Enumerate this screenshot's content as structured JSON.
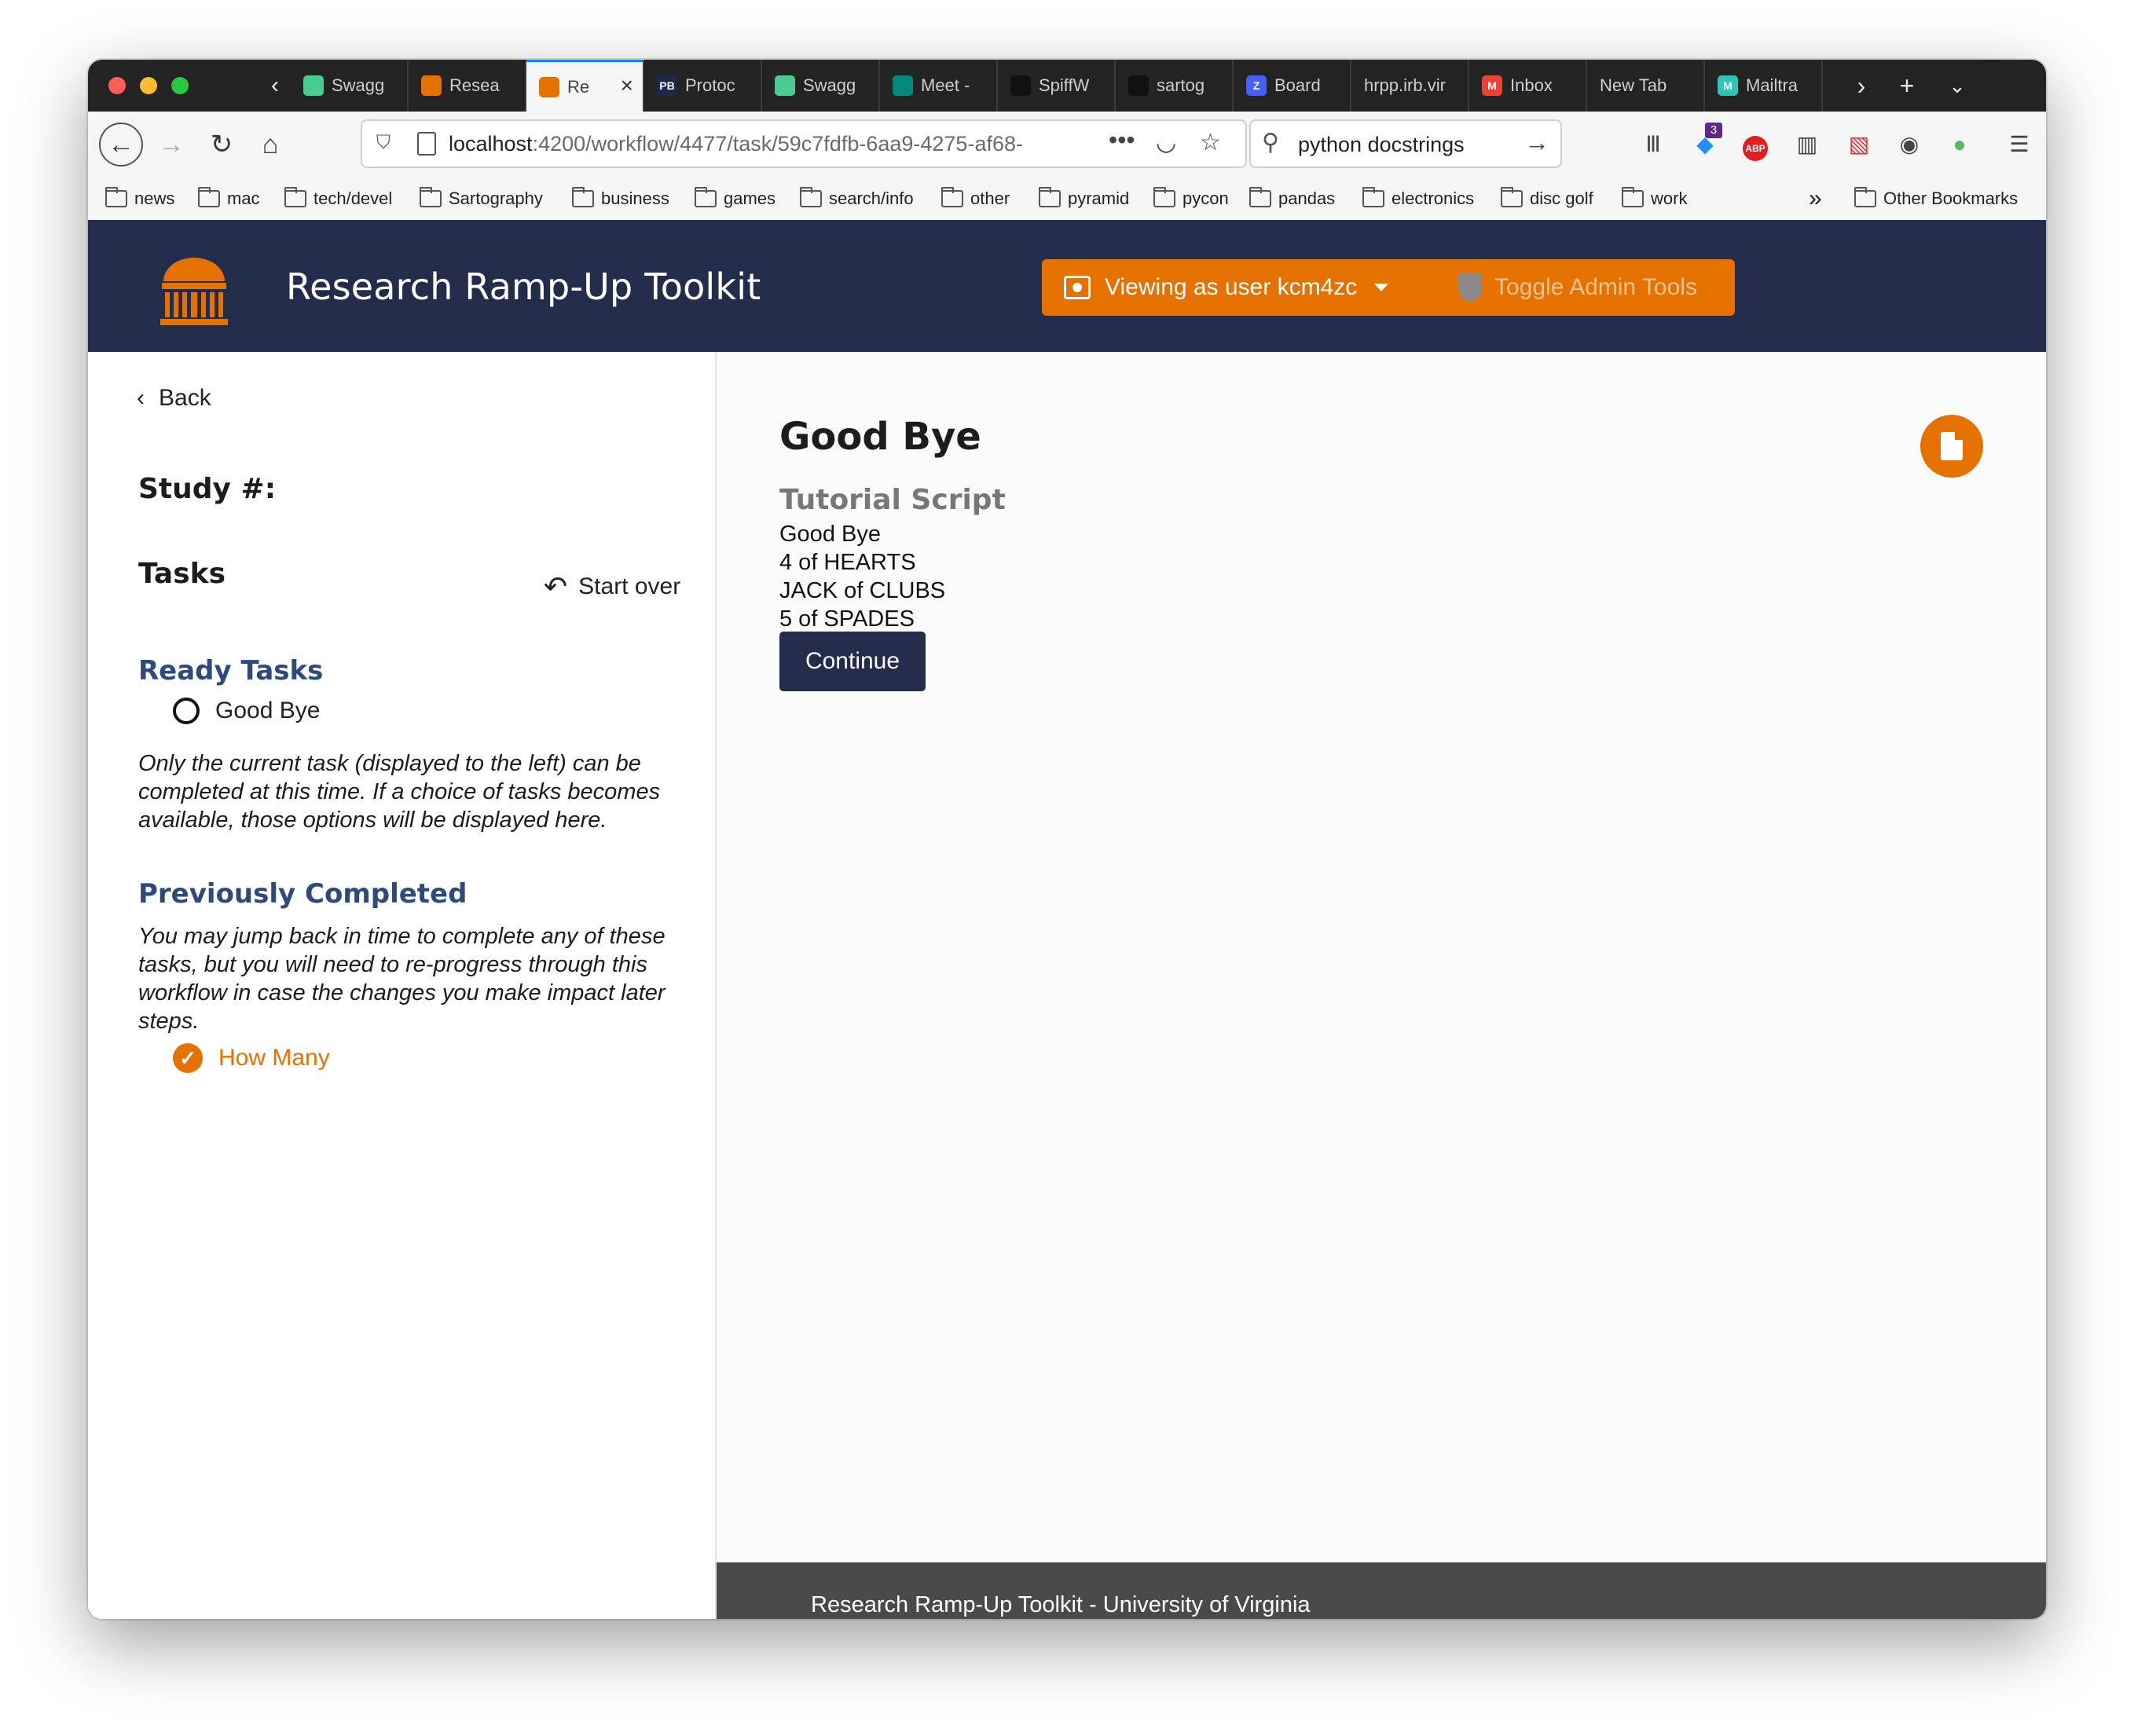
{
  "browser": {
    "tabs": [
      {
        "label": "Swagg",
        "icon": "swagger-icon",
        "color": "#49cc90"
      },
      {
        "label": "Resea",
        "icon": "rotunda-icon",
        "color": "#e57200"
      },
      {
        "label": "Re",
        "icon": "rotunda-icon",
        "color": "#e57200",
        "active": true
      },
      {
        "label": "Protoc",
        "icon": "pb-icon",
        "color": "#1b2a4a",
        "glyph": "PB"
      },
      {
        "label": "Swagg",
        "icon": "swagger-icon",
        "color": "#49cc90"
      },
      {
        "label": "Meet -",
        "icon": "meet-icon",
        "color": "#00897b"
      },
      {
        "label": "SpiffW",
        "icon": "github-icon",
        "color": "#111111"
      },
      {
        "label": "sartog",
        "icon": "github-icon",
        "color": "#111111"
      },
      {
        "label": "Board",
        "icon": "zenhub-icon",
        "color": "#4660f5",
        "glyph": "Z"
      },
      {
        "label": "hrpp.irb.vir",
        "icon": "",
        "color": ""
      },
      {
        "label": "Inbox",
        "icon": "gmail-icon",
        "color": "#ea4335",
        "glyph": "M"
      },
      {
        "label": "New Tab",
        "icon": "",
        "color": ""
      },
      {
        "label": "Mailtra",
        "icon": "mailtrap-icon",
        "color": "#2ec4b6",
        "glyph": "M"
      }
    ],
    "url_host": "localhost",
    "url_rest": ":4200/workflow/4477/task/59c7fdfb-6aa9-4275-af68-",
    "search_value": "python docstrings",
    "notification_badge": "3",
    "bookmarks": [
      "news",
      "mac",
      "tech/devel",
      "Sartography",
      "business",
      "games",
      "search/info",
      "other",
      "pyramid",
      "pycon",
      "pandas",
      "electronics",
      "disc golf",
      "work"
    ],
    "other_bookmarks": "Other Bookmarks"
  },
  "header": {
    "title": "Research Ramp-Up Toolkit",
    "viewing_as": "Viewing as user kcm4zc",
    "toggle_admin": "Toggle Admin Tools"
  },
  "sidebar": {
    "back_label": "Back",
    "study_label": "Study #:",
    "tasks_heading": "Tasks",
    "start_over": "Start over",
    "ready_heading": "Ready Tasks",
    "ready_tasks": [
      "Good Bye"
    ],
    "ready_note": "Only the current task (displayed to the left) can be completed at this time. If a choice of tasks becomes available, those options will be displayed here.",
    "completed_heading": "Previously Completed",
    "completed_note": "You may jump back in time to complete any of these tasks, but you will need to re-progress through this workflow in case the changes you make impact later steps.",
    "completed_tasks": [
      "How Many"
    ]
  },
  "main": {
    "title": "Good Bye",
    "subheading": "Tutorial Script",
    "lines": [
      "Good Bye",
      "4 of HEARTS",
      "JACK of CLUBS",
      "5 of SPADES"
    ],
    "continue_label": "Continue"
  },
  "footer": {
    "text": "Research Ramp-Up Toolkit - University of Virginia"
  },
  "colors": {
    "navy": "#232d4b",
    "orange": "#e57200",
    "section_blue": "#2e4a7c"
  }
}
